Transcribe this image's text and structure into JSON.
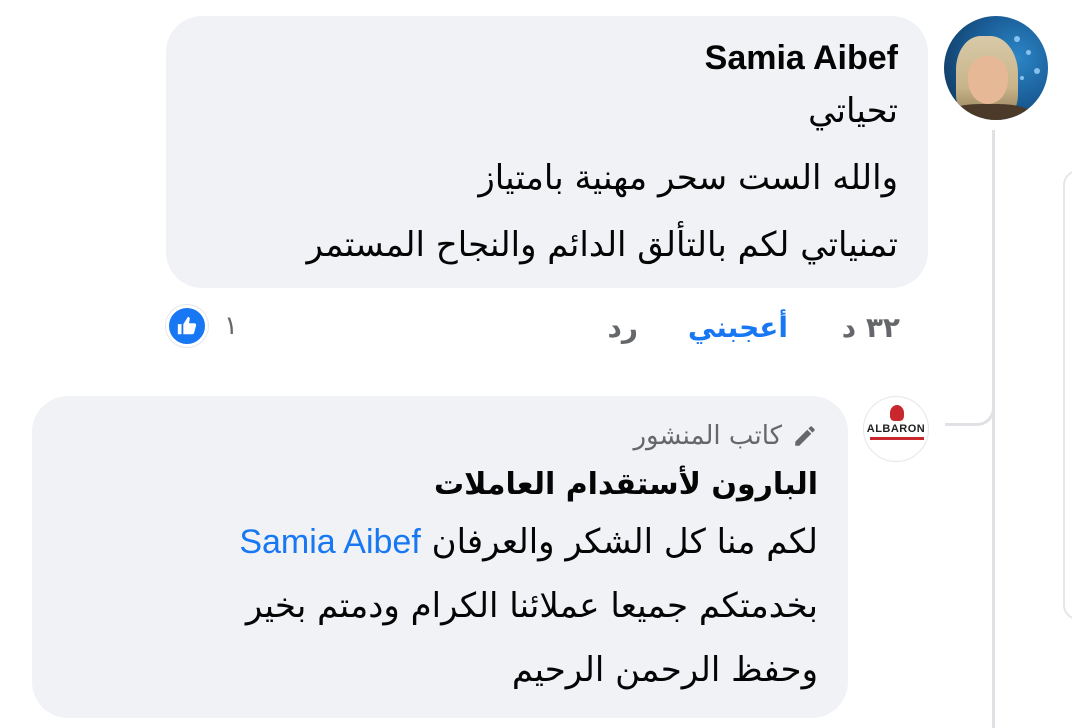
{
  "comment": {
    "author": "Samia Aibef",
    "lines": [
      "تحياتي",
      "والله الست سحر مهنية بامتياز",
      "تمنياتي لكم بالتألق الدائم  والنجاح المستمر"
    ],
    "actions": {
      "time": "٣٢ د",
      "like": "أعجبني",
      "reply": "رد"
    },
    "reactions": {
      "icon": "like-icon",
      "count": "١"
    }
  },
  "reply": {
    "badge_icon": "pencil-icon",
    "badge_label": "كاتب المنشور",
    "page_name": "البارون لأستقدام العاملات",
    "avatar_logo_text": "ALBARON",
    "line1_text": "لكم منا كل الشكر والعرفان",
    "mention": "Samia Aibef",
    "line2": "بخدمتكم جميعا عملائنا الكرام ودمتم بخير",
    "line3": "وحفظ الرحمن الرحيم"
  },
  "colors": {
    "bubble": "#f0f2f5",
    "link_blue": "#1877f2",
    "meta_gray": "#65676b",
    "text": "#050505"
  }
}
